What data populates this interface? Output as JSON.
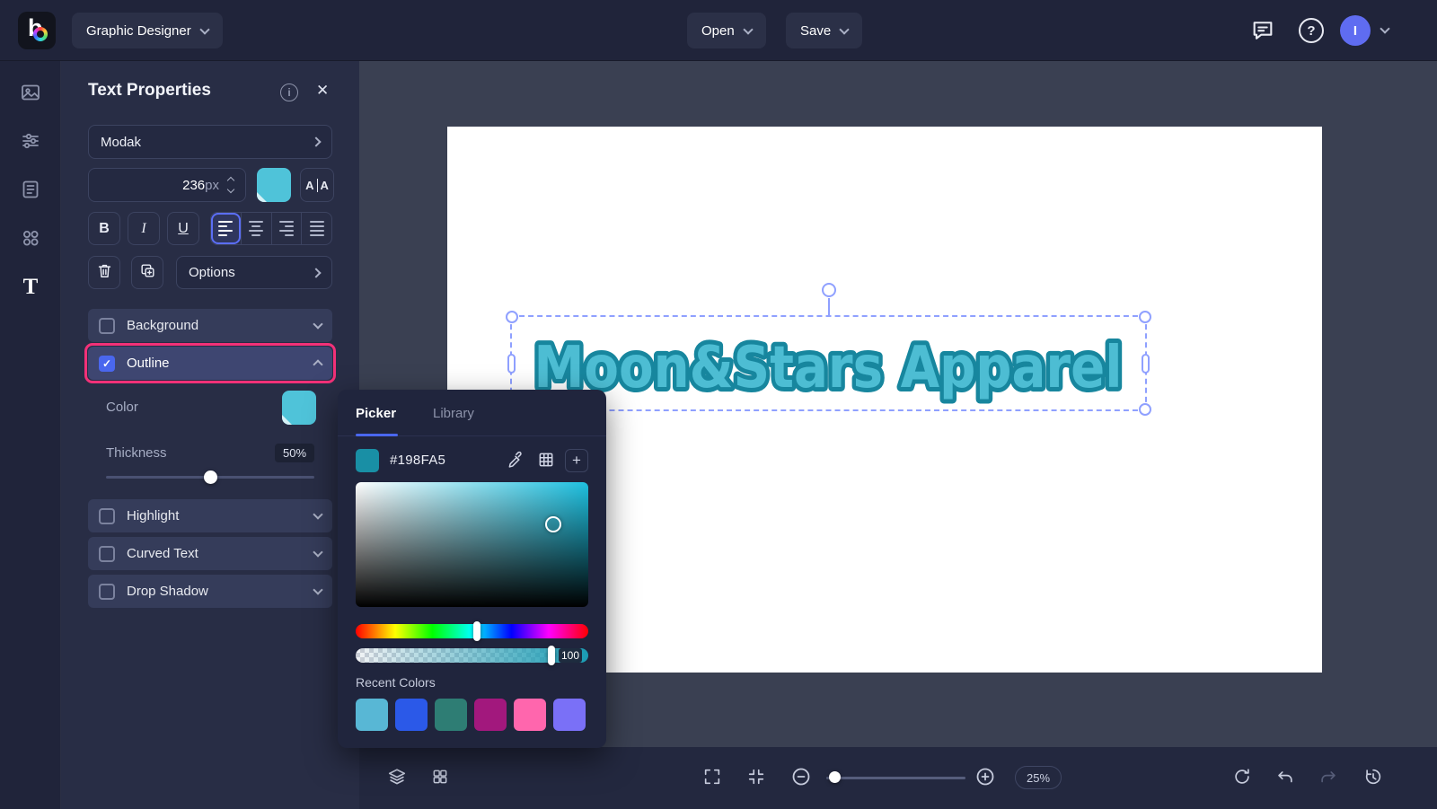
{
  "topbar": {
    "logo_glyph": "b",
    "app_menu_label": "Graphic Designer",
    "open_label": "Open",
    "save_label": "Save",
    "avatar_initial": "I"
  },
  "icons": {
    "help": "?",
    "info": "i",
    "close": "✕",
    "check": "✓",
    "plus": "+"
  },
  "panel": {
    "title": "Text Properties",
    "font_name": "Modak",
    "size_value": "236",
    "size_unit": "px",
    "bold_label": "B",
    "italic_label": "I",
    "underline_label": "U",
    "ls_letter": "A",
    "options_label": "Options",
    "rows": {
      "background": "Background",
      "outline": "Outline",
      "highlight": "Highlight",
      "curved_text": "Curved Text",
      "drop_shadow": "Drop Shadow"
    },
    "outline_section": {
      "color_label": "Color",
      "thickness_label": "Thickness",
      "thickness_value": "50%"
    }
  },
  "picker": {
    "tab_picker": "Picker",
    "tab_library": "Library",
    "hex_value": "#198FA5",
    "alpha_value": "100",
    "recent_label": "Recent Colors",
    "recent_colors": [
      "#58B7D5",
      "#2B59E8",
      "#2E7D74",
      "#A2187D",
      "#FF66AD",
      "#7A70F7"
    ]
  },
  "canvas": {
    "artboard_text": "Moon&Stars Apparel"
  },
  "bottombar": {
    "zoom_value": "25%"
  },
  "colors": {
    "accent": "#4A67EE",
    "swatch_teal": "#4FC3D9",
    "annotation_pink": "#F23178",
    "text_fill": "#4DBDD3",
    "text_stroke": "#17869E"
  }
}
